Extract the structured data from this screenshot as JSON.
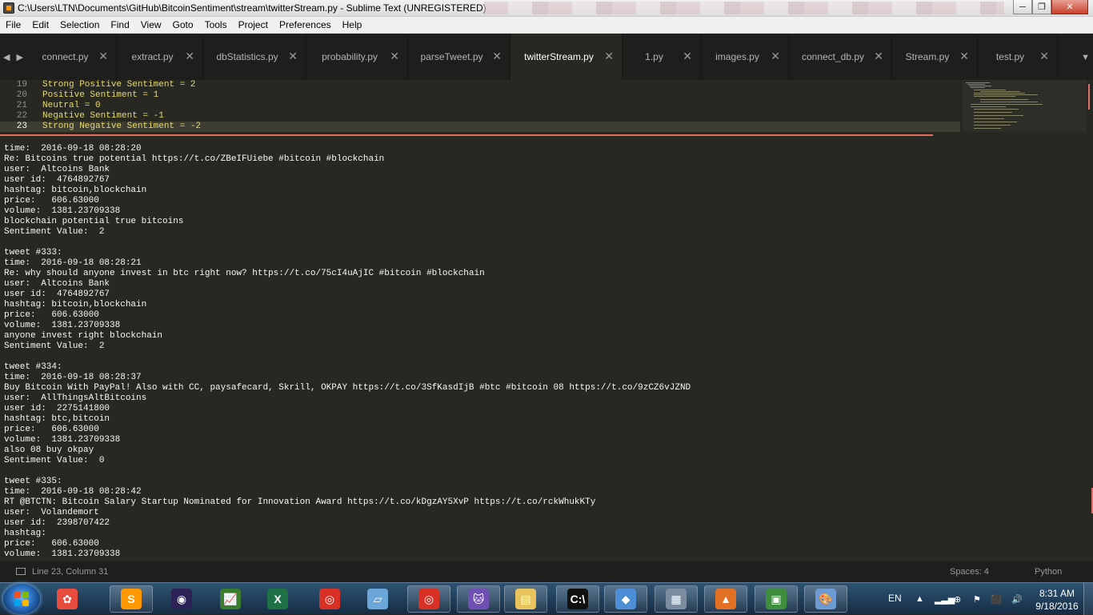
{
  "window": {
    "title": "C:\\Users\\LTN\\Documents\\GitHub\\BitcoinSentiment\\stream\\twitterStream.py - Sublime Text (UNREGISTERED)",
    "minimize_label": "─",
    "maximize_label": "❐",
    "close_label": "✕"
  },
  "menu": [
    "File",
    "Edit",
    "Selection",
    "Find",
    "View",
    "Goto",
    "Tools",
    "Project",
    "Preferences",
    "Help"
  ],
  "tabs": [
    {
      "label": "connect.py",
      "active": false
    },
    {
      "label": "extract.py",
      "active": false
    },
    {
      "label": "dbStatistics.py",
      "active": false
    },
    {
      "label": "probability.py",
      "active": false
    },
    {
      "label": "parseTweet.py",
      "active": false
    },
    {
      "label": "twitterStream.py",
      "active": true
    },
    {
      "label": "1.py",
      "active": false
    },
    {
      "label": "images.py",
      "active": false
    },
    {
      "label": "connect_db.py",
      "active": false
    },
    {
      "label": "Stream.py",
      "active": false
    },
    {
      "label": "test.py",
      "active": false
    }
  ],
  "tab_close_glyph": "✕",
  "tab_nav": {
    "left": "◀",
    "right": "▶",
    "dropdown": "▼"
  },
  "editor": {
    "lines": [
      {
        "num": "19",
        "text": "Strong Positive Sentiment = 2"
      },
      {
        "num": "20",
        "text": "Positive Sentiment = 1"
      },
      {
        "num": "21",
        "text": "Neutral = 0"
      },
      {
        "num": "22",
        "text": "Negative Sentiment = -1"
      },
      {
        "num": "23",
        "text": "Strong Negative Sentiment = -2",
        "current": true
      }
    ]
  },
  "console": [
    "time:  2016-09-18 08:28:20",
    "Re: Bitcoins true potential https://t.co/ZBeIFUiebe #bitcoin #blockchain",
    "user:  Altcoins Bank",
    "user id:  4764892767",
    "hashtag: bitcoin,blockchain",
    "price:   606.63000",
    "volume:  1381.23709338",
    "blockchain potential true bitcoins",
    "Sentiment Value:  2",
    "",
    "tweet #333:",
    "time:  2016-09-18 08:28:21",
    "Re: why should anyone invest in btc right now? https://t.co/75cI4uAjIC #bitcoin #blockchain",
    "user:  Altcoins Bank",
    "user id:  4764892767",
    "hashtag: bitcoin,blockchain",
    "price:   606.63000",
    "volume:  1381.23709338",
    "anyone invest right blockchain",
    "Sentiment Value:  2",
    "",
    "tweet #334:",
    "time:  2016-09-18 08:28:37",
    "Buy Bitcoin With PayPal! Also with CC, paysafecard, Skrill, OKPAY https://t.co/3SfKasdIjB #btc #bitcoin 08 https://t.co/9zCZ6vJZND",
    "user:  AllThingsAltBitcoins",
    "user id:  2275141800",
    "hashtag: btc,bitcoin",
    "price:   606.63000",
    "volume:  1381.23709338",
    "also 08 buy okpay",
    "Sentiment Value:  0",
    "",
    "tweet #335:",
    "time:  2016-09-18 08:28:42",
    "RT @BTCTN: Bitcoin Salary Startup Nominated for Innovation Award https://t.co/kDgzAY5XvP https://t.co/rckWhukKTy",
    "user:  Volandemort",
    "user id:  2398707422",
    "hashtag:",
    "price:   606.63000",
    "volume:  1381.23709338"
  ],
  "status": {
    "position": "Line 23, Column 31",
    "spaces": "Spaces: 4",
    "syntax": "Python"
  },
  "taskbar": {
    "apps": [
      {
        "name": "picasa-icon",
        "glyph": "✿",
        "color": "#e84c3d",
        "running": false
      },
      {
        "name": "sublime-text-icon",
        "glyph": "S",
        "color": "#ff9800",
        "running": true
      },
      {
        "name": "eclipse-icon",
        "glyph": "◉",
        "color": "#2c2255",
        "running": false
      },
      {
        "name": "chart-app-icon",
        "glyph": "📈",
        "color": "#3a7d2e",
        "running": false
      },
      {
        "name": "excel-icon",
        "glyph": "X",
        "color": "#1e7145",
        "running": false
      },
      {
        "name": "chrome-icon",
        "glyph": "◎",
        "color": "#d93025",
        "running": false
      },
      {
        "name": "notes-icon",
        "glyph": "▱",
        "color": "#6aa6d8",
        "running": false
      },
      {
        "name": "chrome-icon-2",
        "glyph": "◎",
        "color": "#d93025",
        "running": true
      },
      {
        "name": "github-icon",
        "glyph": "🐱",
        "color": "#6e4fb3",
        "running": true
      },
      {
        "name": "file-explorer-icon",
        "glyph": "▤",
        "color": "#e8c25a",
        "running": true
      },
      {
        "name": "command-prompt-icon",
        "glyph": "C:\\",
        "color": "#111111",
        "running": true
      },
      {
        "name": "git-icon",
        "glyph": "◆",
        "color": "#4d8fd6",
        "running": true
      },
      {
        "name": "calculator-icon",
        "glyph": "▦",
        "color": "#7c8da0",
        "running": true
      },
      {
        "name": "matlab-icon",
        "glyph": "▲",
        "color": "#e16f24",
        "running": true
      },
      {
        "name": "task-manager-icon",
        "glyph": "▣",
        "color": "#3e8e3e",
        "running": true
      },
      {
        "name": "paint-icon",
        "glyph": "🎨",
        "color": "#6b9bd2",
        "running": true
      }
    ],
    "language": "EN",
    "time": "8:31 AM",
    "date": "9/18/2016",
    "tray_icons": [
      "▲",
      "▂▃▅",
      "⊕",
      "⚑",
      "⬛",
      "🔊"
    ]
  }
}
